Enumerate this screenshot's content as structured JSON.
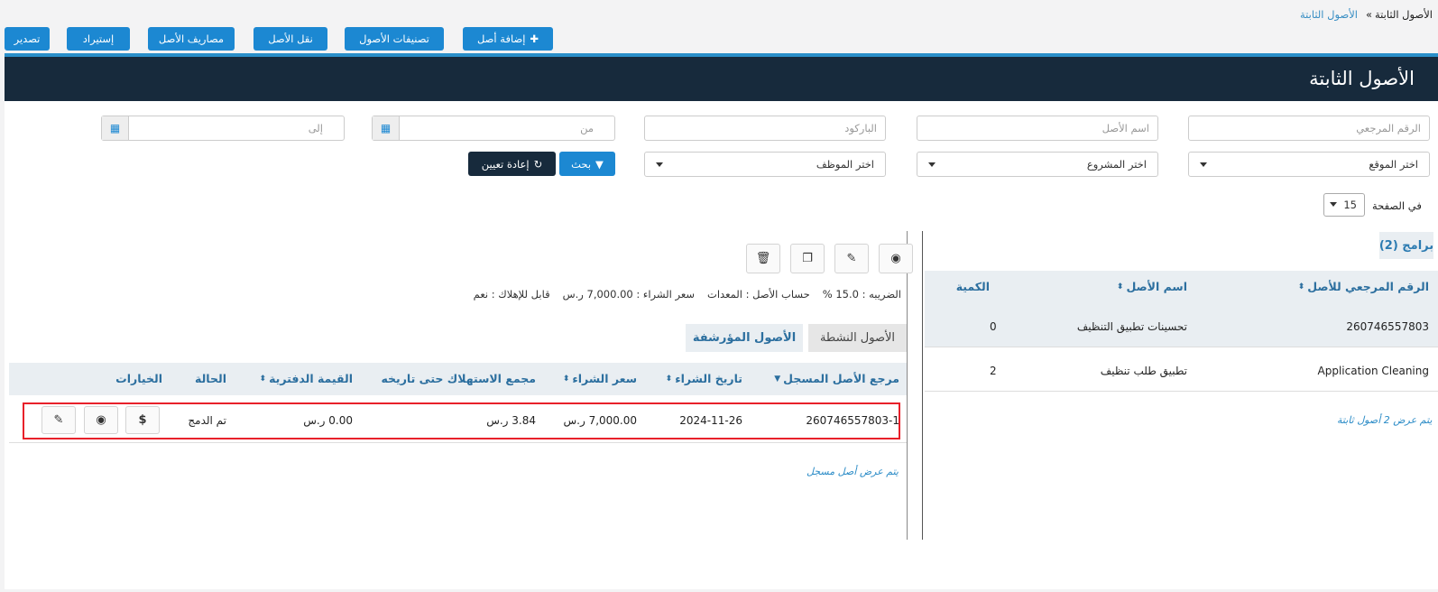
{
  "breadcrumb": {
    "root": "الأصول الثابتة",
    "separator": "»",
    "current": "الأصول الثابتة"
  },
  "toolbar": {
    "add_asset": "إضافة أصل",
    "asset_categories": "تصنيفات الأصول",
    "transfer_asset": "نقل الأصل",
    "asset_expenses": "مصاريف الأصل",
    "import": "إستيراد",
    "export": "تصدير"
  },
  "page": {
    "title": "الأصول الثابتة"
  },
  "filters": {
    "ref_placeholder": "الرقم المرجعي",
    "name_placeholder": "اسم الأصل",
    "barcode_placeholder": "الباركود",
    "from_placeholder": "من",
    "to_placeholder": "إلى",
    "location_select": "اختر الموقع",
    "project_select": "اختر المشروع",
    "employee_select": "اختر الموظف",
    "search_label": "بحث",
    "reset_label": "إعادة تعيين"
  },
  "pagination": {
    "per_page_label": "في الصفحة",
    "per_page_value": "15"
  },
  "programs": {
    "badge": "برامج (2)",
    "columns": {
      "ref": "الرقم المرجعي للأصل",
      "name": "اسم الأصل",
      "qty": "الكمية"
    },
    "rows": [
      {
        "ref": "260746557803",
        "name": "تحسينات تطبيق التنظيف",
        "qty": "0"
      },
      {
        "ref": "Application Cleaning",
        "name": "تطبيق طلب تنظيف",
        "qty": "2"
      }
    ],
    "footer_note": "يتم عرض 2 أصول ثابتة"
  },
  "details": {
    "tax": "الضريبه : 15.0 %",
    "account": "حساب الأصل : المعدات",
    "purchase_price": "سعر الشراء : 7,000.00 ر.س",
    "depreciable": "قابل للإهلاك : نعم"
  },
  "tabs": {
    "active_assets": "الأصول النشطة",
    "archived_assets": "الأصول المؤرشفة"
  },
  "registered": {
    "columns": {
      "ref": "مرجع الأصل المسجل",
      "date": "تاريخ الشراء",
      "price": "سعر الشراء",
      "accum_dep": "مجمع الاستهلاك حتى تاريخه",
      "book_value": "القيمة الدفترية",
      "status": "الحالة",
      "options": "الخيارات"
    },
    "rows": [
      {
        "ref": "260746557803-1",
        "date": "2024-11-26",
        "price": "7,000.00 ر.س",
        "accum_dep": "3.84 ر.س",
        "book_value": "0.00 ر.س",
        "status": "تم الدمج"
      }
    ],
    "footer_note": "يتم عرض أصل مسجل"
  },
  "colors": {
    "primary": "#1c88d2",
    "header_dark": "#172a3c",
    "highlight": "#e8202a"
  }
}
